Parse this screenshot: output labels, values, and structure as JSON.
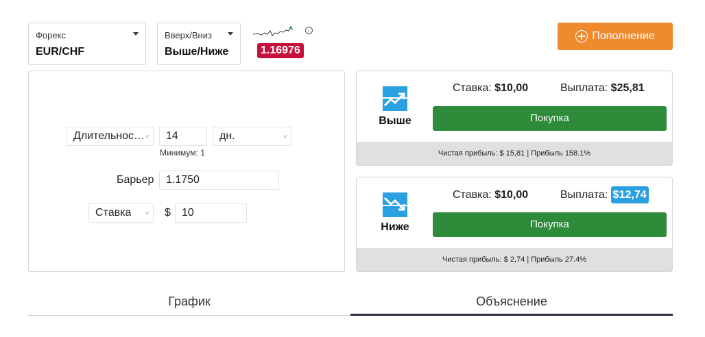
{
  "market": {
    "label": "Форекс",
    "value": "EUR/CHF"
  },
  "trade_type": {
    "label": "Вверх/Вниз",
    "value": "Выше/Ниже"
  },
  "spot_price": "1.16976",
  "info_icon": "info-icon",
  "topup": {
    "label": "Пополнение",
    "icon": "plus-circle-icon"
  },
  "form": {
    "duration_select": "Длительнос…",
    "duration_value": "14",
    "duration_unit": "дн.",
    "minimum_hint": "Минимум: 1",
    "barrier_label": "Барьер",
    "barrier_value": "1.1750",
    "stake_select": "Ставка",
    "currency_symbol": "$",
    "stake_value": "10"
  },
  "contracts": [
    {
      "direction": "Выше",
      "icon": "rise-arrow-icon",
      "stake_label": "Ставка:",
      "stake_value": "$10,00",
      "payout_label": "Выплата:",
      "payout_value": "$25,81",
      "buy_label": "Покупка",
      "footer": "Чистая прибыль: $ 15,81 | Прибыль 158.1%"
    },
    {
      "direction": "Ниже",
      "icon": "fall-arrow-icon",
      "stake_label": "Ставка:",
      "stake_value": "$10,00",
      "payout_label": "Выплата:",
      "payout_value": "$12,74",
      "buy_label": "Покупка",
      "footer": "Чистая прибыль: $ 2,74 | Прибыль 27.4%"
    }
  ],
  "tabs": [
    {
      "label": "График",
      "active": false
    },
    {
      "label": "Объяснение",
      "active": true
    }
  ],
  "colors": {
    "accent_orange": "#ef8a2e",
    "price_red": "#c8103e",
    "buy_green": "#2e8b3a",
    "icon_blue": "#2aa0e0"
  }
}
